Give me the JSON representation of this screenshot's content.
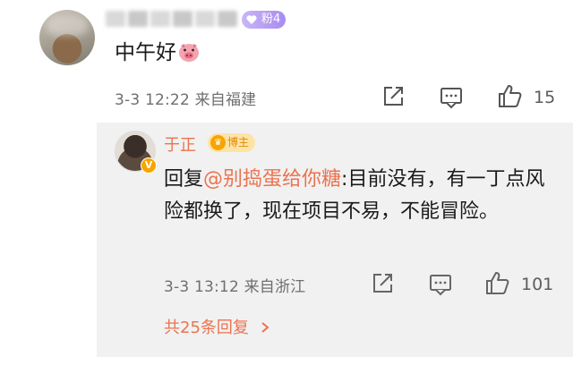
{
  "comment": {
    "fan_badge": "粉4",
    "text": "中午好",
    "emoji": "pig-face-emoji",
    "time": "3-3 12:22",
    "location": "来自福建",
    "like_count": "15"
  },
  "reply": {
    "username": "于正",
    "badge": "博主",
    "reply_prefix": "回复",
    "mention": "@别捣蛋给你糖",
    "text": ":目前没有，有一丁点风险都换了，现在项目不易，不能冒险。",
    "time": "3-3 13:12",
    "location": "来自浙江",
    "like_count": "101",
    "more_replies": "共25条回复"
  },
  "colors": {
    "accent": "#eb7350",
    "meta_gray": "#6f6f6f",
    "badge_bg": "#ffe3a6",
    "fan_badge_bg": "#a78bf0",
    "reply_bg": "#f1f1f1"
  }
}
